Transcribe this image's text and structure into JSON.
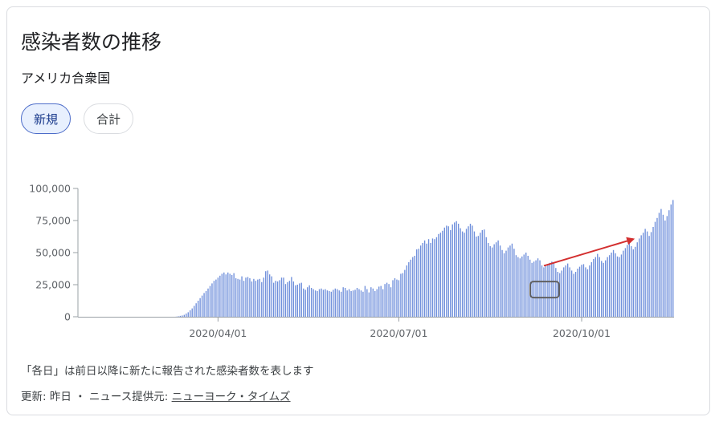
{
  "card": {
    "title": "感染者数の推移",
    "subtitle": "アメリカ合衆国",
    "tabs": [
      {
        "label": "新規",
        "selected": true
      },
      {
        "label": "合計",
        "selected": false
      }
    ],
    "note": "「各日」は前日以降に新たに報告された感染者数を表します",
    "footer": {
      "prefix": "更新: 昨日 ・ ニュース提供元: ",
      "source_link": "ニューヨーク・タイムズ"
    }
  },
  "colors": {
    "bar": "#6f8fdb",
    "axis": "#9aa0a6",
    "grid": "#e8eaed",
    "annotation_arrow": "#d32f2f",
    "annotation_box": "#616161"
  },
  "chart_data": {
    "type": "bar",
    "title": "",
    "xlabel": "",
    "ylabel": "",
    "ylim": [
      0,
      100000
    ],
    "y_ticks": [
      0,
      25000,
      50000,
      75000,
      100000
    ],
    "y_tick_labels": [
      "0",
      "25,000",
      "50,000",
      "75,000",
      "100,000"
    ],
    "x_start": "2020-01-22",
    "x_ticks": [
      {
        "date": "2020-04-01",
        "label": "2020/04/01"
      },
      {
        "date": "2020-07-01",
        "label": "2020/07/01"
      },
      {
        "date": "2020-10-01",
        "label": "2020/10/01"
      }
    ],
    "grid": false,
    "legend": "none",
    "series": [
      {
        "values": [
          0,
          0,
          0,
          0,
          0,
          0,
          0,
          0,
          0,
          0,
          0,
          0,
          0,
          0,
          0,
          0,
          0,
          0,
          0,
          0,
          0,
          0,
          0,
          0,
          0,
          0,
          0,
          0,
          0,
          0,
          0,
          0,
          0,
          0,
          0,
          0,
          0,
          0,
          0,
          0,
          0,
          0,
          0,
          0,
          0,
          0,
          0,
          0,
          0,
          100,
          400,
          700,
          1000,
          1500,
          2500,
          3500,
          5000,
          6500,
          8500,
          10500,
          12500,
          14500,
          16500,
          18500,
          20000,
          22000,
          24000,
          26000,
          28000,
          29000,
          30500,
          32000,
          33500,
          34500,
          33000,
          34500,
          33500,
          32500,
          34000,
          30000,
          29500,
          29000,
          31500,
          28000,
          30500,
          31000,
          30000,
          27500,
          29500,
          28000,
          29000,
          29500,
          27000,
          30500,
          35500,
          36000,
          33000,
          31500,
          26500,
          28000,
          27500,
          28500,
          30500,
          30500,
          25500,
          27000,
          28000,
          31000,
          27500,
          24500,
          25000,
          26000,
          26500,
          22000,
          21000,
          23000,
          24500,
          22500,
          21500,
          20500,
          20000,
          21500,
          22000,
          21000,
          21500,
          20500,
          20000,
          19500,
          21000,
          22000,
          21500,
          20500,
          19500,
          23000,
          22500,
          20500,
          21500,
          20000,
          20500,
          21000,
          22500,
          21500,
          20500,
          19500,
          24000,
          21500,
          19000,
          23000,
          22000,
          20000,
          21500,
          23500,
          24000,
          21500,
          25500,
          26500,
          25500,
          23000,
          28500,
          30000,
          29000,
          28500,
          33500,
          34000,
          36500,
          40000,
          42500,
          44500,
          46500,
          47500,
          52500,
          53000,
          55500,
          57500,
          59500,
          57000,
          60500,
          57500,
          61000,
          60500,
          62000,
          64500,
          65500,
          67000,
          69500,
          71000,
          70500,
          67500,
          72000,
          73500,
          74500,
          72500,
          69000,
          66500,
          65500,
          68500,
          70500,
          72500,
          71000,
          66500,
          62500,
          63000,
          65500,
          67500,
          68000,
          62000,
          57500,
          55000,
          54000,
          56500,
          58000,
          59500,
          55500,
          52000,
          49500,
          51500,
          54000,
          55500,
          57000,
          53000,
          48000,
          46500,
          45500,
          47000,
          48500,
          50000,
          47500,
          44500,
          42000,
          43000,
          44000,
          45500,
          44000,
          40000,
          38500,
          39500,
          41000,
          42000,
          43000,
          41500,
          38000,
          35000,
          34000,
          36000,
          38500,
          40000,
          41500,
          38500,
          36000,
          33500,
          35000,
          37500,
          39000,
          40500,
          41000,
          38500,
          37000,
          40000,
          42500,
          45000,
          46500,
          49000,
          46500,
          43500,
          42000,
          44000,
          46500,
          48000,
          50000,
          52000,
          49500,
          47000,
          46500,
          48500,
          51500,
          53500,
          56000,
          57500,
          55000,
          52500,
          54500,
          58000,
          61000,
          63500,
          65500,
          68500,
          66500,
          63000,
          66000,
          70000,
          74000,
          77000,
          81000,
          84000,
          79500,
          75000,
          78500,
          83000,
          87500,
          91000
        ]
      }
    ]
  },
  "annotations": [
    {
      "type": "arrow",
      "from": "2020-09-12",
      "to": "2020-10-27"
    },
    {
      "type": "box",
      "around": "2020-09-12"
    }
  ]
}
